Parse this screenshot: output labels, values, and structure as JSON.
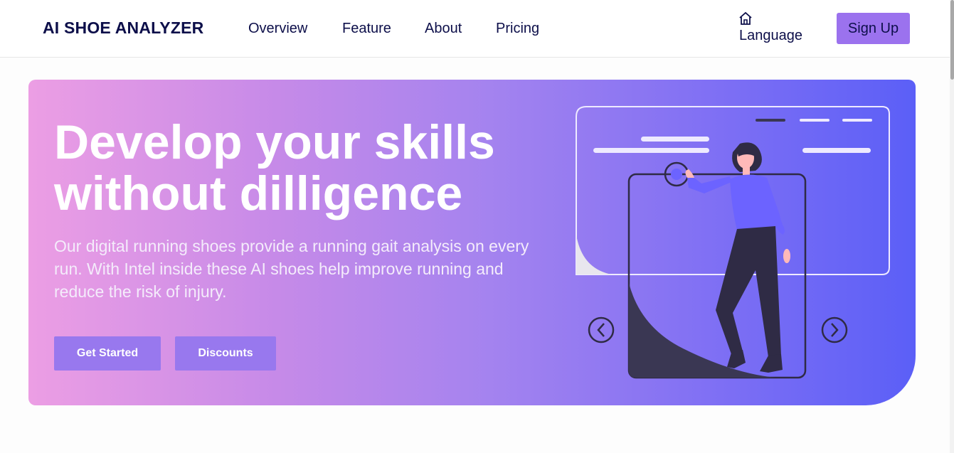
{
  "header": {
    "brand": "AI SHOE ANALYZER",
    "nav": [
      {
        "label": "Overview"
      },
      {
        "label": "Feature"
      },
      {
        "label": "About"
      },
      {
        "label": "Pricing"
      }
    ],
    "language_label": "Language",
    "language_icon": "home-icon",
    "signup_label": "Sign Up"
  },
  "hero": {
    "title_line1": "Develop your skills",
    "title_line2": "without dilligence",
    "description": "Our digital running shoes provide a running gait analysis on every run. With Intel inside these AI shoes help improve running and reduce the risk of injury.",
    "buttons": {
      "get_started": "Get Started",
      "discounts": "Discounts"
    },
    "illustration": {
      "icons": [
        "carousel-prev-icon",
        "carousel-next-icon"
      ]
    }
  },
  "colors": {
    "brand_text": "#0d0f4a",
    "accent_button": "#9b72ee",
    "gradient_start": "#ec9ee4",
    "gradient_end": "#5b5ff7"
  }
}
